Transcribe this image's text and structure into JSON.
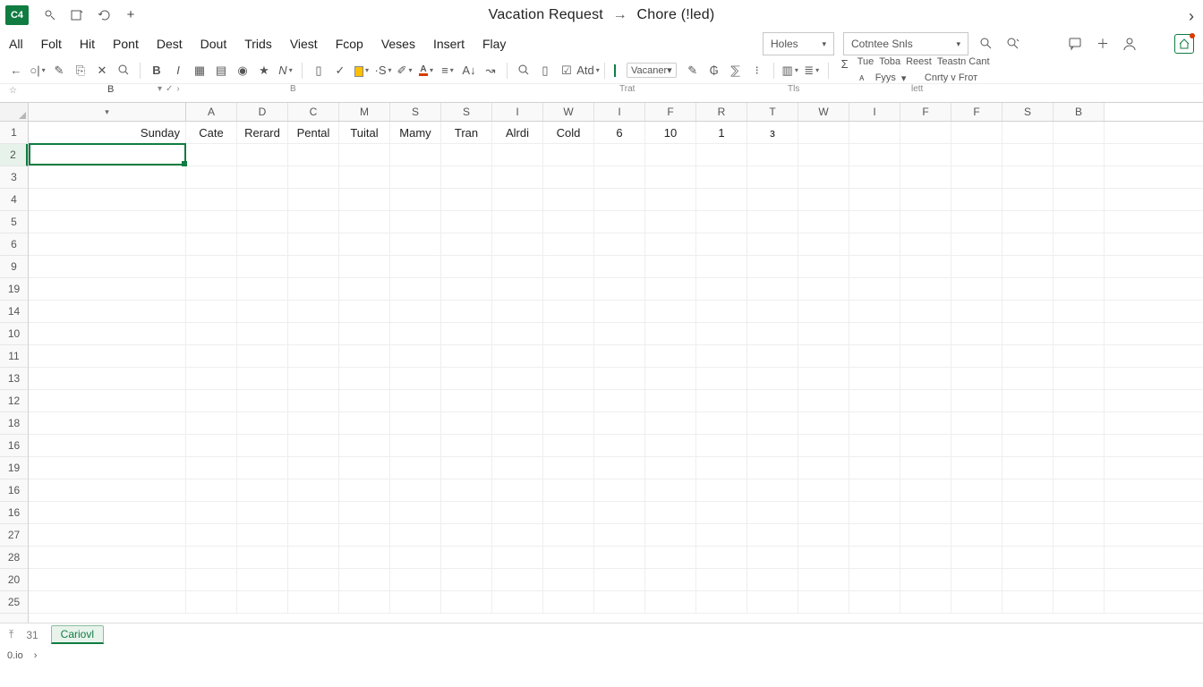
{
  "title": {
    "app_badge": "C4",
    "doc_left": "Vacation Request",
    "arrow": "→",
    "doc_right": "Chore (!led)"
  },
  "tabs": [
    "All",
    "Folt",
    "Hit",
    "Pont",
    "Dest",
    "Dout",
    "Trids",
    "Viest",
    "Fcop",
    "Veses",
    "Insert",
    "Flay"
  ],
  "combos": {
    "holes": "Holes",
    "content": "Cotntee Snls"
  },
  "toolbar": {
    "atd": "Atd",
    "vacaner": "Vacaner",
    "labels_top": [
      "Tue",
      "Toba",
      "Reest",
      "Teastn Cant"
    ],
    "labels_bot": [
      "",
      "Fyys",
      "",
      "Cnrty v Frот"
    ]
  },
  "name_box": "B",
  "formula_groups": {
    "g1": "",
    "g2": "Trat",
    "g3": "Tls",
    "g4": "lett"
  },
  "columns": [
    "A",
    "D",
    "C",
    "M",
    "S",
    "S",
    "I",
    "W",
    "I",
    "F",
    "R",
    "T",
    "W",
    "I",
    "F",
    "F",
    "S",
    "B"
  ],
  "row1": {
    "wide": "Sunday",
    "cells": [
      "Cate",
      "Rerard",
      "Pental",
      "Tuital",
      "Mamy",
      "Tran",
      "Alrdi",
      "Cold",
      "6",
      "10",
      "1",
      "з",
      "",
      "",
      "",
      "",
      "",
      ""
    ]
  },
  "row_numbers": [
    "1",
    "2",
    "3",
    "4",
    "5",
    "6",
    "9",
    "19",
    "14",
    "10",
    "11",
    "13",
    "12",
    "18",
    "16",
    "19",
    "16",
    "16",
    "27",
    "28",
    "20",
    "25"
  ],
  "sheet": {
    "page": "31",
    "tab": "Cariovl"
  },
  "status": {
    "left": "0.io"
  }
}
